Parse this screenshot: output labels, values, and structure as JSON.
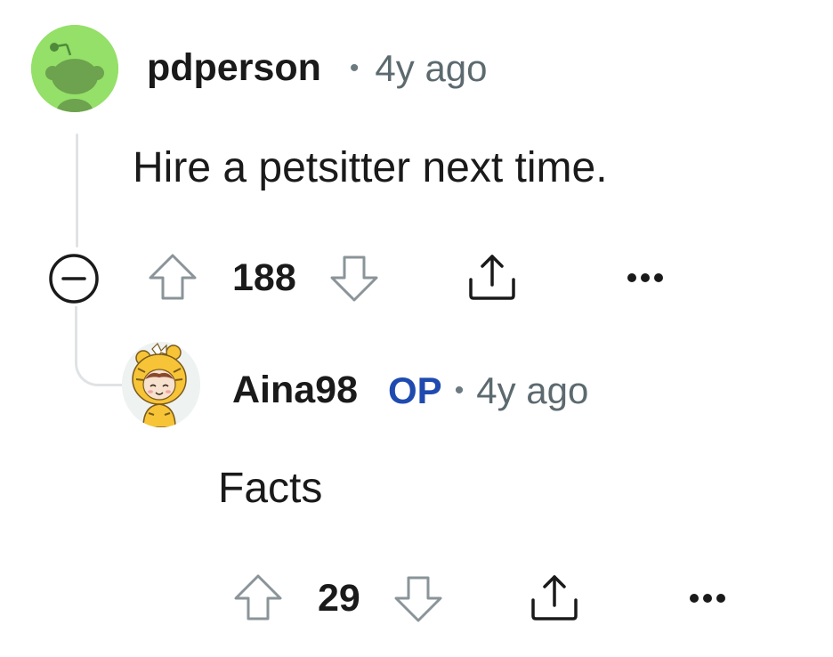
{
  "comments": [
    {
      "username": "pdperson",
      "separator": "•",
      "timestamp": "4y ago",
      "body": "Hire a petsitter next time.",
      "score": "188",
      "avatar": "snoo-avatar-green",
      "actions": [
        "upvote-icon",
        "downvote-icon",
        "share-icon",
        "more-options-icon"
      ]
    },
    {
      "username": "Aina98",
      "badge": "OP",
      "separator": "•",
      "timestamp": "4y ago",
      "body": "Facts",
      "score": "29",
      "avatar": "tiger-costume-avatar",
      "actions": [
        "upvote-icon",
        "downvote-icon",
        "share-icon",
        "more-options-icon"
      ]
    }
  ],
  "thread": {
    "collapse_icon": "collapse-minus-icon"
  },
  "colors": {
    "op_badge": "#1f4bb0",
    "meta_text": "#5c6a70",
    "icon_stroke": "#8a9499",
    "thread_line": "#e0e3e5",
    "avatar_green": "#94e068"
  }
}
